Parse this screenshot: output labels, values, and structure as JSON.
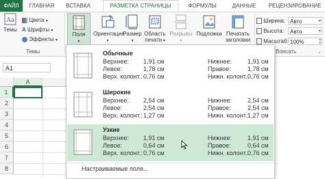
{
  "tabs": [
    {
      "label": "ФАЙЛ"
    },
    {
      "label": "ГЛАВНАЯ"
    },
    {
      "label": "ВСТАВКА"
    },
    {
      "label": "РАЗМЕТКА СТРАНИЦЫ"
    },
    {
      "label": "ФОРМУЛЫ"
    },
    {
      "label": "ДАННЫЕ"
    },
    {
      "label": "РЕЦЕНЗИРОВАНИЕ"
    }
  ],
  "ribbon": {
    "themes": {
      "button": "Темы",
      "colors": "Цвета",
      "fonts": "Шрифты",
      "effects": "Эффекты",
      "group": "Темы"
    },
    "margins": "Поля",
    "orientation": "Ориентация",
    "size": "Размер",
    "print_area_1": "Область",
    "print_area_2": "печати",
    "breaks": "Разрывы",
    "background": "Подложка",
    "print_titles_1": "Печатать",
    "print_titles_2": "заголовки",
    "width_label": "Ширина:",
    "width_value": "Авто",
    "height_label": "Высота:",
    "height_value": "Авто",
    "scale_label": "Масштаб:",
    "scale_value": "100%",
    "fit_group": "Вписать"
  },
  "namebox": "A1",
  "columns": [
    "A"
  ],
  "rows": [
    "1",
    "2",
    "3",
    "4",
    "5",
    "6",
    "7",
    "8"
  ],
  "margins_menu": {
    "options": [
      {
        "name": "Обычные",
        "left": [
          [
            "Верхнее:",
            "1,91 см"
          ],
          [
            "Левое:",
            "1,78 см"
          ],
          [
            "Верх. колонт.:",
            "0,76 см"
          ]
        ],
        "right": [
          [
            "Нижнее:",
            "1,91 см"
          ],
          [
            "Правое:",
            "1,78 см"
          ],
          [
            "Нижн. колонт.:",
            "0,76 см"
          ]
        ]
      },
      {
        "name": "Широкие",
        "left": [
          [
            "Верхнее:",
            "2,54 см"
          ],
          [
            "Левое:",
            "2,54 см"
          ],
          [
            "Верх. колонт.:",
            "1,27 см"
          ]
        ],
        "right": [
          [
            "Нижнее:",
            "2,54 см"
          ],
          [
            "Правое:",
            "2,54 см"
          ],
          [
            "Нижн. колонт.:",
            "1,27 см"
          ]
        ]
      },
      {
        "name": "Узкие",
        "left": [
          [
            "Верхнее:",
            "1,91 см"
          ],
          [
            "Левое:",
            "0,64 см"
          ],
          [
            "Верх. колонт.:",
            "0,76 см"
          ]
        ],
        "right": [
          [
            "Нижнее:",
            "1,91 см"
          ],
          [
            "Правое:",
            "0,64 см"
          ],
          [
            "Нижн. колонт.:",
            "0,76 см"
          ]
        ]
      }
    ],
    "custom_label": "Настраиваемые поля..."
  },
  "colors": {
    "accent": "#217346",
    "highlight": "#cde9d6"
  }
}
